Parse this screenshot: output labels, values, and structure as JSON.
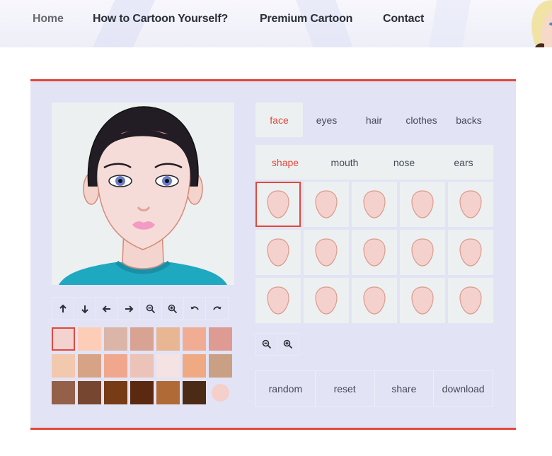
{
  "nav": {
    "items": [
      {
        "label": "Home",
        "active": true
      },
      {
        "label": "How to Cartoon Yourself?"
      },
      {
        "label": "Premium Cartoon"
      },
      {
        "label": "Contact"
      }
    ]
  },
  "theme": {
    "accent": "#e2483a",
    "panel_bg": "#e3e3f6",
    "tile_bg": "#ecf0f1",
    "text": "#444b55"
  },
  "editor": {
    "controls": [
      {
        "icon": "arrow-up-icon",
        "action": "move up"
      },
      {
        "icon": "arrow-down-icon",
        "action": "move down"
      },
      {
        "icon": "arrow-left-icon",
        "action": "move left"
      },
      {
        "icon": "arrow-right-icon",
        "action": "move right"
      },
      {
        "icon": "zoom-out-icon",
        "action": "zoom out"
      },
      {
        "icon": "zoom-in-icon",
        "action": "zoom in"
      },
      {
        "icon": "undo-icon",
        "action": "undo"
      },
      {
        "icon": "redo-icon",
        "action": "redo"
      }
    ],
    "skin_colors": [
      "#f3d3d0",
      "#fdcdb8",
      "#dbb6a8",
      "#d8a393",
      "#e8b693",
      "#f1ad94",
      "#de9b93",
      "#f2c8ae",
      "#d6a387",
      "#f1a78d",
      "#ebc3b8",
      "#f4e3e2",
      "#efa983",
      "#c9a084",
      "#946049",
      "#774630",
      "#773b15",
      "#5b2810",
      "#b06a35",
      "#4b2b16",
      "#f5d0ca"
    ],
    "selected_skin_index": 0,
    "tabs": [
      {
        "label": "face",
        "active": true
      },
      {
        "label": "eyes"
      },
      {
        "label": "hair"
      },
      {
        "label": "clothes"
      },
      {
        "label": "backs"
      }
    ],
    "subtabs": [
      {
        "label": "shape",
        "active": true
      },
      {
        "label": "mouth"
      },
      {
        "label": "nose"
      },
      {
        "label": "ears"
      }
    ],
    "shape_options_count": 15,
    "selected_shape_index": 0,
    "grid_zoom": [
      {
        "icon": "zoom-out-icon",
        "action": "zoom out"
      },
      {
        "icon": "zoom-in-icon",
        "action": "zoom in"
      }
    ],
    "actions": {
      "random": "random",
      "reset": "reset",
      "share": "share",
      "download": "download"
    }
  }
}
